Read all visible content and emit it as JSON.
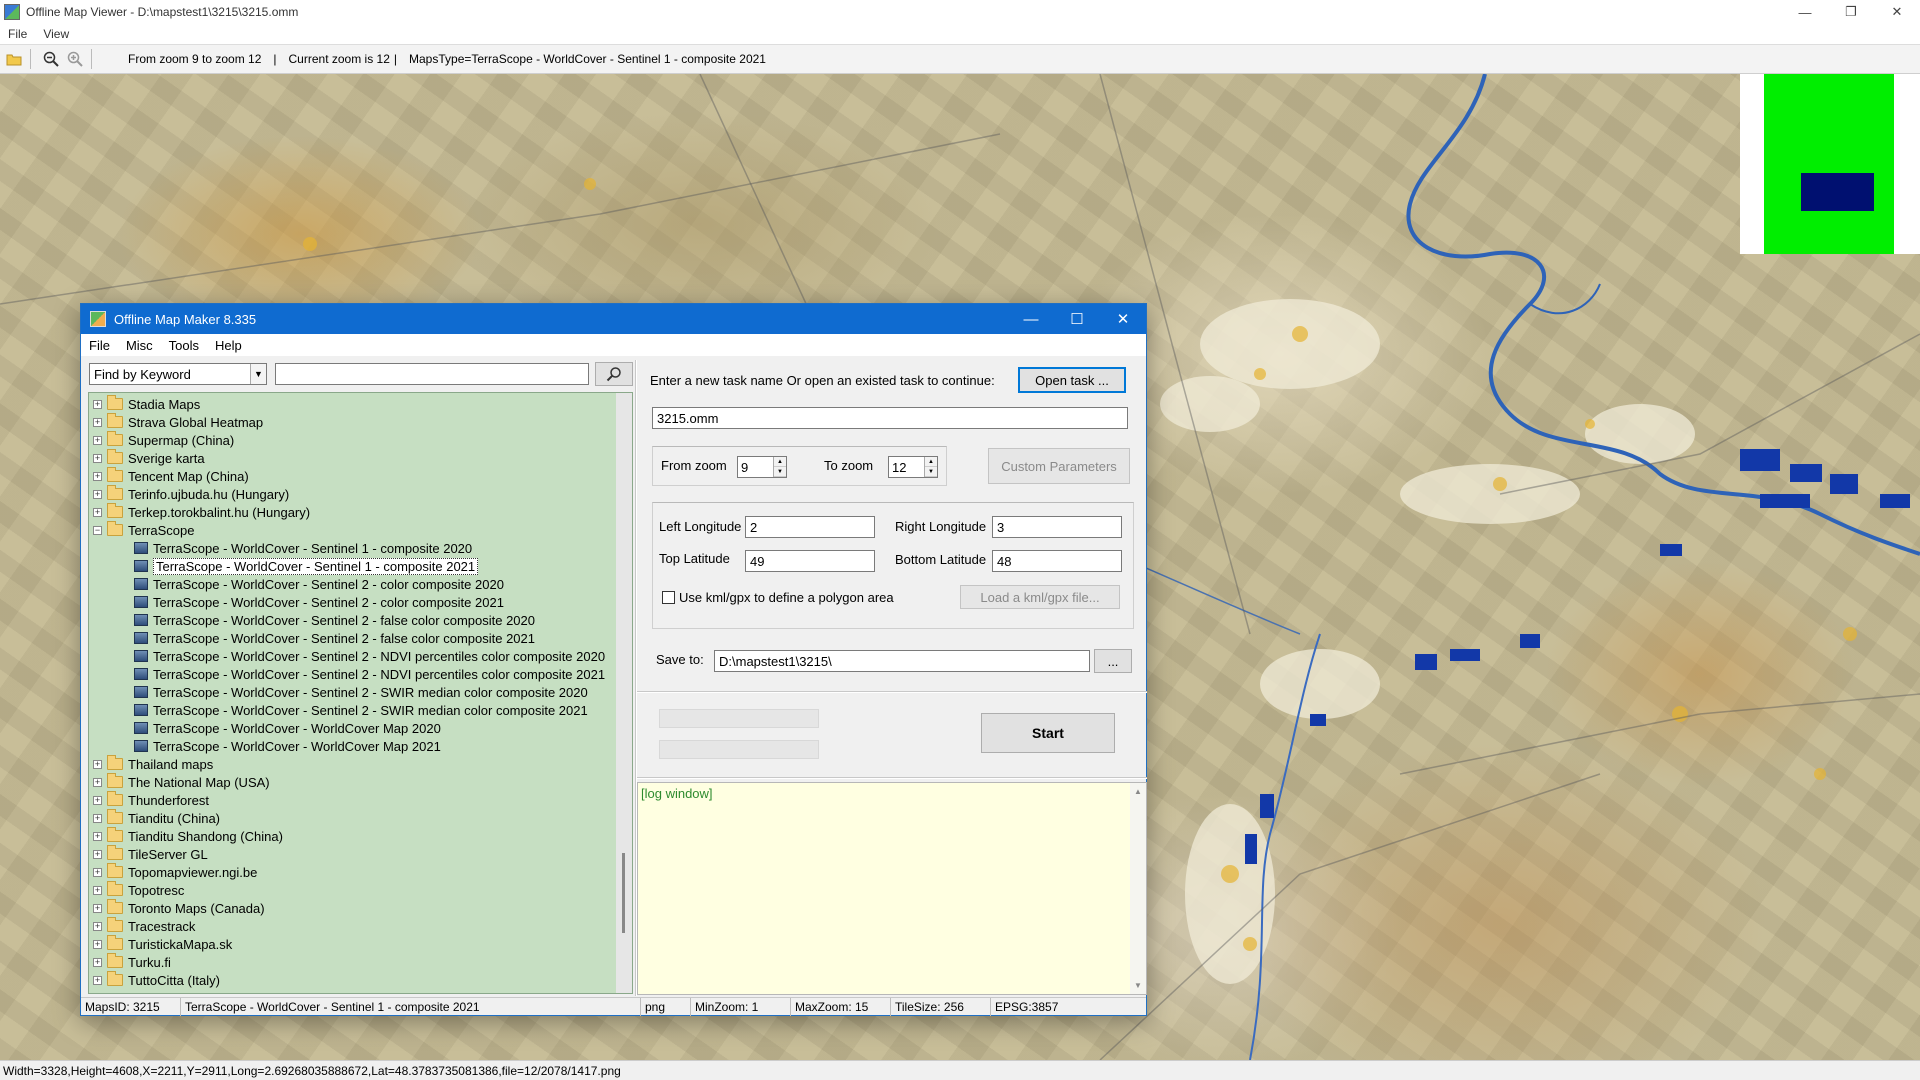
{
  "viewer": {
    "title": "Offline Map Viewer - D:\\mapstest1\\3215\\3215.omm",
    "menu": [
      "File",
      "View"
    ],
    "toolbar": {
      "zoom_range": "From zoom 9 to zoom 12",
      "current_zoom": "Current zoom is 12",
      "maps_type": "MapsType=TerraScope - WorldCover - Sentinel 1 - composite 2021",
      "sep1": "|",
      "sep2": "|"
    },
    "status": "Width=3328,Height=4608,X=2211,Y=2911,Long=2.69268035888672,Lat=48.3783735081386,file=12/2078/1417.png",
    "overview_colors": {
      "background": "#00ee00",
      "viewport": "#001070"
    }
  },
  "dialog": {
    "title": "Offline Map Maker 8.335",
    "menu": [
      "File",
      "Misc",
      "Tools",
      "Help"
    ],
    "search": {
      "mode": "Find by Keyword",
      "value": ""
    },
    "tree": [
      {
        "label": "Stadia Maps",
        "type": "folder",
        "expanded": false
      },
      {
        "label": "Strava Global Heatmap",
        "type": "folder",
        "expanded": false
      },
      {
        "label": "Supermap (China)",
        "type": "folder",
        "expanded": false
      },
      {
        "label": "Sverige karta",
        "type": "folder",
        "expanded": false
      },
      {
        "label": "Tencent Map (China)",
        "type": "folder",
        "expanded": false
      },
      {
        "label": "Terinfo.ujbuda.hu (Hungary)",
        "type": "folder",
        "expanded": false
      },
      {
        "label": "Terkep.torokbalint.hu (Hungary)",
        "type": "folder",
        "expanded": false
      },
      {
        "label": "TerraScope",
        "type": "folder",
        "expanded": true
      },
      {
        "label": "TerraScope - WorldCover - Sentinel 1 - composite 2020",
        "type": "map"
      },
      {
        "label": "TerraScope - WorldCover - Sentinel 1 - composite 2021",
        "type": "map",
        "selected": true
      },
      {
        "label": "TerraScope - WorldCover - Sentinel 2 - color composite 2020",
        "type": "map"
      },
      {
        "label": "TerraScope - WorldCover - Sentinel 2 - color composite 2021",
        "type": "map"
      },
      {
        "label": "TerraScope - WorldCover - Sentinel 2 - false color composite 2020",
        "type": "map"
      },
      {
        "label": "TerraScope - WorldCover - Sentinel 2 - false color composite 2021",
        "type": "map"
      },
      {
        "label": "TerraScope - WorldCover - Sentinel 2 - NDVI percentiles color composite 2020",
        "type": "map"
      },
      {
        "label": "TerraScope - WorldCover - Sentinel 2 - NDVI percentiles color composite 2021",
        "type": "map"
      },
      {
        "label": "TerraScope - WorldCover - Sentinel 2 - SWIR median color composite 2020",
        "type": "map"
      },
      {
        "label": "TerraScope - WorldCover - Sentinel 2 - SWIR median color composite 2021",
        "type": "map"
      },
      {
        "label": "TerraScope - WorldCover - WorldCover Map 2020",
        "type": "map"
      },
      {
        "label": "TerraScope - WorldCover - WorldCover Map 2021",
        "type": "map"
      },
      {
        "label": "Thailand maps",
        "type": "folder",
        "expanded": false
      },
      {
        "label": "The National Map (USA)",
        "type": "folder",
        "expanded": false
      },
      {
        "label": "Thunderforest",
        "type": "folder",
        "expanded": false
      },
      {
        "label": "Tianditu (China)",
        "type": "folder",
        "expanded": false
      },
      {
        "label": "Tianditu Shandong (China)",
        "type": "folder",
        "expanded": false
      },
      {
        "label": "TileServer GL",
        "type": "folder",
        "expanded": false
      },
      {
        "label": "Topomapviewer.ngi.be",
        "type": "folder",
        "expanded": false
      },
      {
        "label": "Topotresc",
        "type": "folder",
        "expanded": false
      },
      {
        "label": "Toronto Maps (Canada)",
        "type": "folder",
        "expanded": false
      },
      {
        "label": "Tracestrack",
        "type": "folder",
        "expanded": false
      },
      {
        "label": "TuristickaMapa.sk",
        "type": "folder",
        "expanded": false
      },
      {
        "label": "Turku.fi",
        "type": "folder",
        "expanded": false
      },
      {
        "label": "TuttoCitta (Italy)",
        "type": "folder",
        "expanded": false
      }
    ],
    "task": {
      "prompt": "Enter a new task name Or open an existed task to continue:",
      "open_button": "Open task ...",
      "name": "3215.omm"
    },
    "zoom": {
      "from_label": "From zoom",
      "from_value": "9",
      "to_label": "To zoom",
      "to_value": "12",
      "custom_button": "Custom Parameters"
    },
    "bounds": {
      "left_label": "Left Longitude",
      "left_value": "2",
      "right_label": "Right Longitude",
      "right_value": "3",
      "top_label": "Top Latitude",
      "top_value": "49",
      "bottom_label": "Bottom Latitude",
      "bottom_value": "48",
      "kml_label": "Use kml/gpx to define a polygon area",
      "kml_checked": false,
      "kml_button": "Load a kml/gpx file..."
    },
    "save": {
      "label": "Save to:",
      "value": "D:\\mapstest1\\3215\\",
      "browse_button": "..."
    },
    "progress": {
      "bar1": 0,
      "bar2": 0
    },
    "start_button": "Start",
    "log": "[log window]",
    "status": {
      "maps_id": "MapsID: 3215",
      "map_name": "TerraScope - WorldCover - Sentinel 1 - composite 2021",
      "format": "png",
      "min_zoom": "MinZoom: 1",
      "max_zoom": "MaxZoom: 15",
      "tile_size": "TileSize: 256",
      "epsg": "EPSG:3857"
    }
  }
}
